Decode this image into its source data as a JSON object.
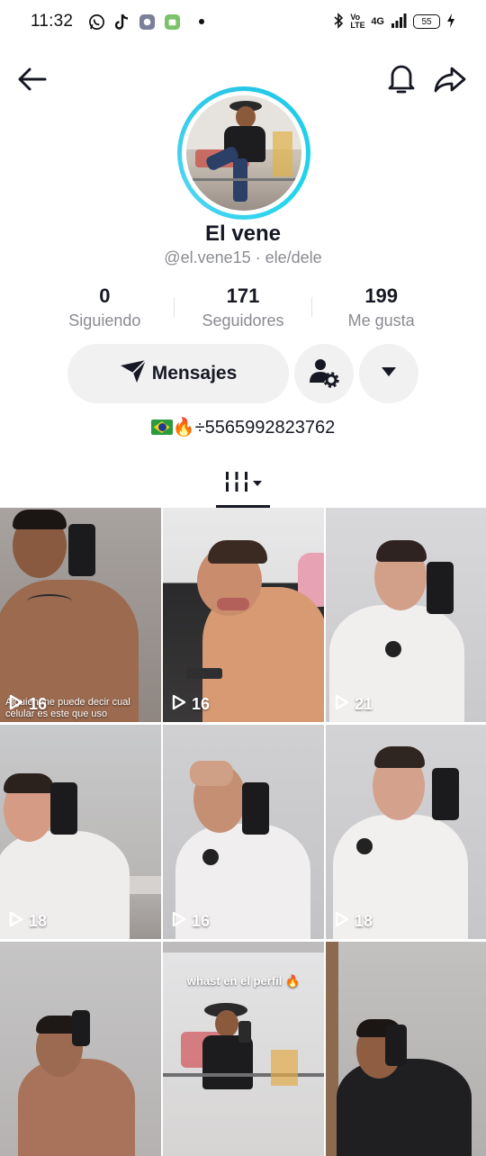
{
  "status_bar": {
    "time": "11:32",
    "battery": "55",
    "network": "4G",
    "volte": "Vo LTE"
  },
  "profile": {
    "name": "El vene",
    "handle": "@el.vene15 · ele/dele",
    "bio_text": "🔥÷5565992823762",
    "ring_color": "#25c6e6"
  },
  "stats": [
    {
      "value": "0",
      "label": "Siguiendo"
    },
    {
      "value": "171",
      "label": "Seguidores"
    },
    {
      "value": "199",
      "label": "Me gusta"
    }
  ],
  "actions": {
    "message_label": "Mensajes"
  },
  "videos": [
    {
      "views": "16",
      "caption": "Alguien me puede  decir cual celular es este que uso"
    },
    {
      "views": "16",
      "caption": ""
    },
    {
      "views": "21",
      "caption": ""
    },
    {
      "views": "18",
      "caption": ""
    },
    {
      "views": "16",
      "caption": ""
    },
    {
      "views": "18",
      "caption": ""
    },
    {
      "views": "",
      "caption": ""
    },
    {
      "views": "",
      "caption": "",
      "overlay": "whast en el perfil 🔥"
    },
    {
      "views": "",
      "caption": ""
    }
  ]
}
